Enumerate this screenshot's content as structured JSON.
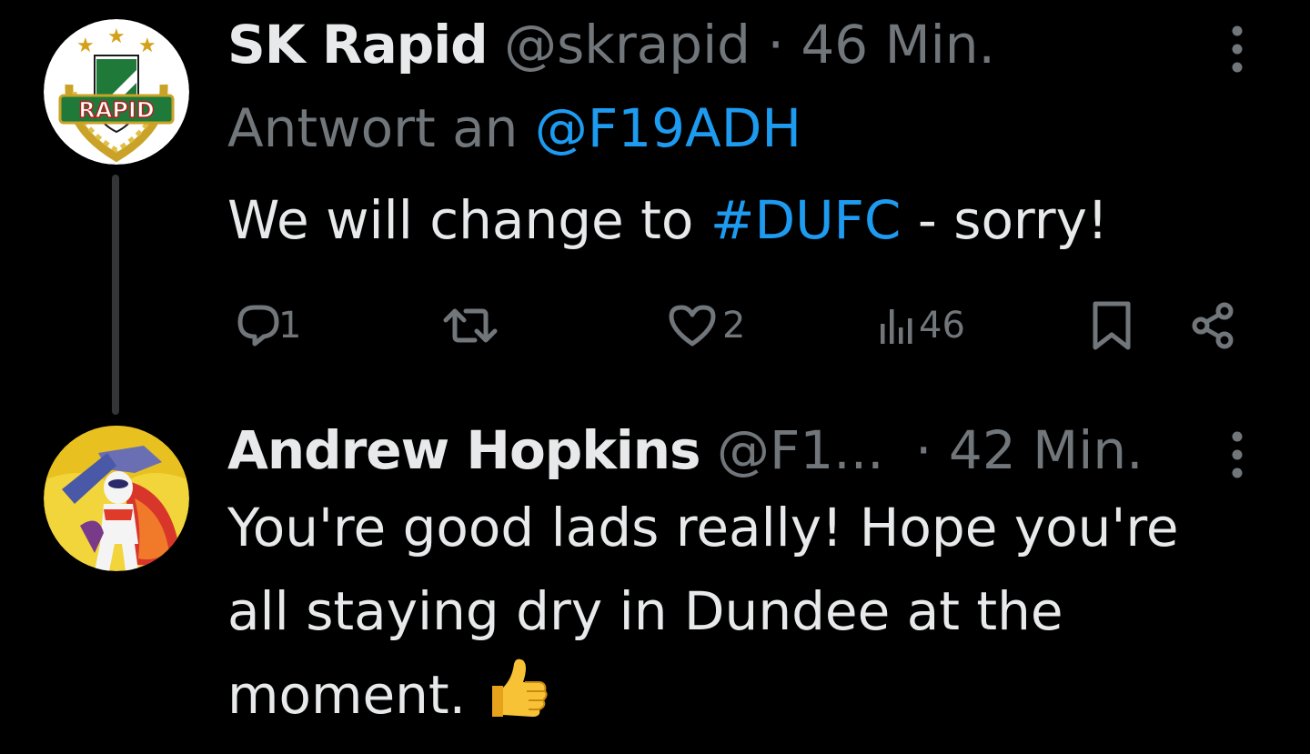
{
  "tweet1": {
    "display_name": "SK Rapid",
    "handle": "@skrapid",
    "separator": "·",
    "time": "46 Min.",
    "replying_prefix": "Antwort an",
    "replying_to": "@F19ADH",
    "text_before": "We will change to",
    "hashtag": "#DUFC",
    "text_after": "- sorry!",
    "avatar_text": "RAPID",
    "actions": {
      "reply_count": "1",
      "retweet_count": "",
      "like_count": "2",
      "views_count": "46"
    }
  },
  "tweet2": {
    "display_name": "Andrew Hopkins",
    "handle": "@F1...",
    "separator": "·",
    "time": "42 Min.",
    "text_lines": [
      "You're good lads really! Hope you're",
      "all staying dry in Dundee at the",
      "moment."
    ],
    "emoji": "thumbs-up"
  },
  "colors": {
    "background": "#000000",
    "text": "#e7e9ea",
    "muted": "#71767b",
    "link": "#1d9bf0",
    "thread_line": "#333639"
  },
  "icons": [
    "reply-icon",
    "retweet-icon",
    "like-icon",
    "views-icon",
    "bookmark-icon",
    "share-icon",
    "more-options-icon",
    "thumbs-up-emoji"
  ]
}
